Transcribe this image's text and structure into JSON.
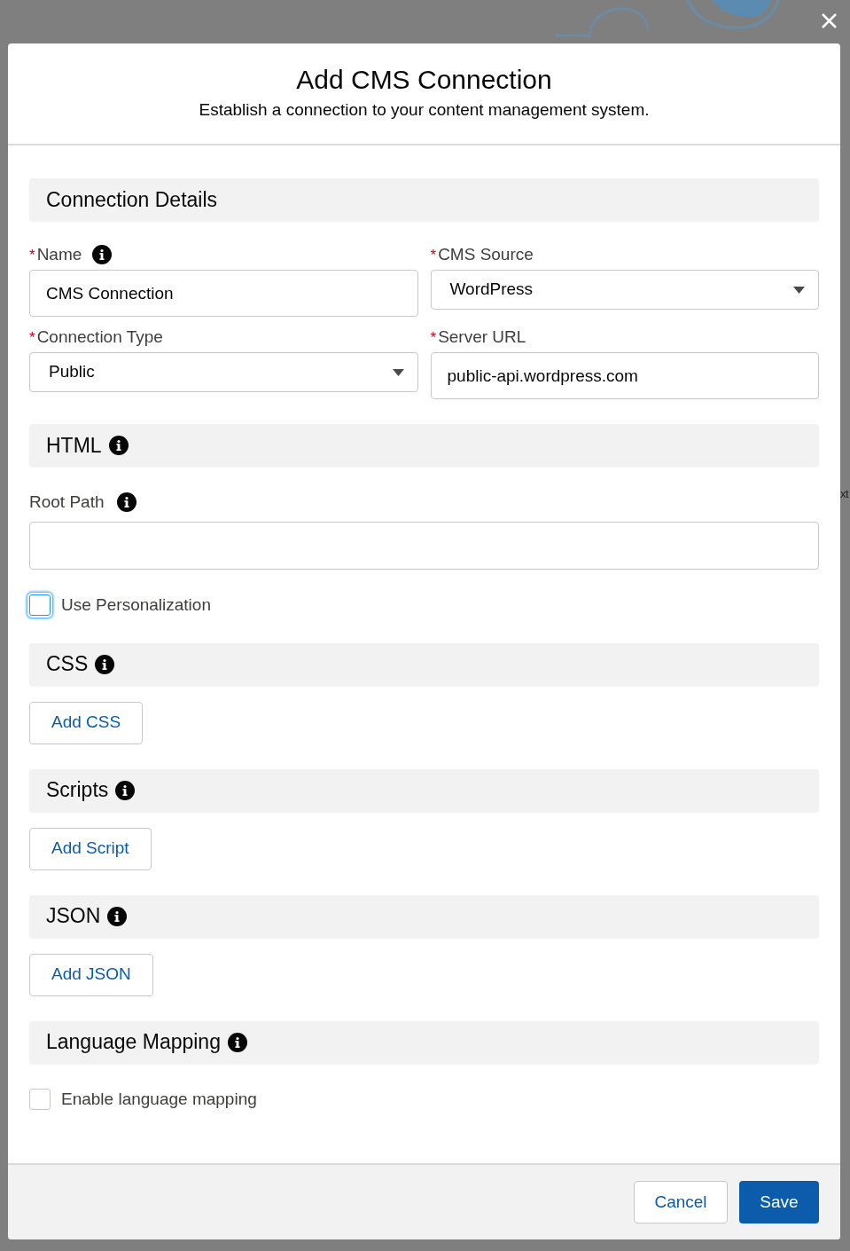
{
  "backdrop": {
    "edge_text": "xt"
  },
  "modal": {
    "title": "Add CMS Connection",
    "subtitle": "Establish a connection to your content management system.",
    "sections": [
      {
        "kind": "fields",
        "title": "Connection Details",
        "fields": [
          {
            "kind": "input",
            "required_mark": "*",
            "label": "Name",
            "info": true,
            "value": "CMS Connection"
          },
          {
            "kind": "select",
            "required_mark": "*",
            "label": "CMS Source",
            "value": "WordPress"
          },
          {
            "kind": "select",
            "required_mark": "*",
            "label": "Connection Type",
            "value": "Public"
          },
          {
            "kind": "input",
            "required_mark": "*",
            "label": "Server URL",
            "value": "public-api.wordpress.com"
          }
        ]
      },
      {
        "kind": "html",
        "title": "HTML",
        "info": true,
        "root_path": {
          "label": "Root Path",
          "info": true
        },
        "checkbox": {
          "label": "Use Personalization",
          "checked": false,
          "focused": true
        }
      },
      {
        "kind": "button",
        "title": "CSS",
        "info": true,
        "button": "Add CSS"
      },
      {
        "kind": "button",
        "title": "Scripts",
        "info": true,
        "button": "Add Script"
      },
      {
        "kind": "button",
        "title": "JSON",
        "info": true,
        "button": "Add JSON"
      },
      {
        "kind": "checkbox",
        "title": "Language Mapping",
        "info": true,
        "checkbox": {
          "label": "Enable language mapping",
          "checked": false,
          "focused": false
        }
      }
    ],
    "footer": {
      "cancel": "Cancel",
      "save": "Save"
    }
  }
}
